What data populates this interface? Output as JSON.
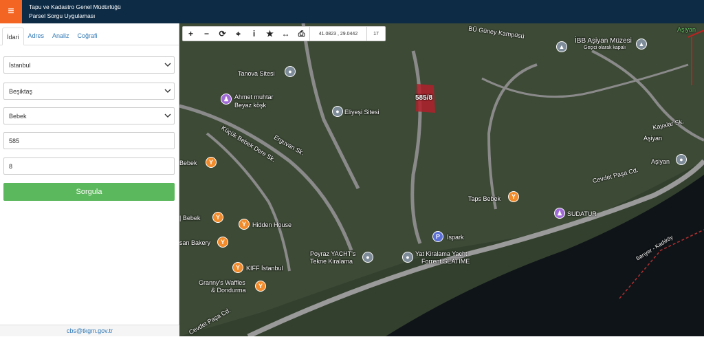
{
  "header": {
    "menu_icon": "≡",
    "title": "Tapu ve Kadastro Genel Müdürlüğü",
    "subtitle": "Parsel Sorgu Uygulaması",
    "bg_color": "#0d2b45",
    "accent_color": "#f26522"
  },
  "sidebar": {
    "tabs": [
      {
        "label": "İdari"
      },
      {
        "label": "Adres"
      },
      {
        "label": "Analiz"
      },
      {
        "label": "Coğrafi"
      }
    ],
    "fields": {
      "province": "İstanbul",
      "district": "Beşiktaş",
      "neighborhood": "Bebek",
      "block": "585",
      "parcel": "8"
    },
    "submit_label": "Sorgula",
    "submit_color": "#5cb85c",
    "footer_email": "cbs@tkgm.gov.tr"
  },
  "map": {
    "toolbar": {
      "zoom_in": "+",
      "zoom_out": "−",
      "refresh": "⟳",
      "locate": "⌖",
      "info": "i",
      "bookmark": "★",
      "measure": "↔",
      "print": "⎙",
      "coordinates": "41.0823 , 29.0442",
      "zoom_level": "17"
    },
    "parcel_label": "585/8",
    "labels": {
      "bu_guney": "BÜ Güney Kampüsü",
      "ibb_asiyan": "İBB Aşiyan Müzesi",
      "gecici": "Geçici olarak kapalı",
      "asiyan_top": "Aşiyan",
      "tanova": "Tanova Sitesi",
      "ahmet_1": "Ahmet muhtar",
      "ahmet_2": "Beyaz köşk",
      "eliyesi": "Eliyeşi Sitesi",
      "kayalar": "Kayalar Sk.",
      "asiyan_1": "Aşiyan",
      "asiyan_2": "Aşiyan",
      "bebek": "Bebek",
      "kucuk_bebek": "Küçük Bebek Dere Sk.",
      "erguvan": "Erguvan Sk.",
      "cevdet": "Cevdet Paşa Cd.",
      "taps": "Taps Bebek",
      "sudatur": "SUDATUR",
      "bebek_left": "| Bebek",
      "hidden": "Hidden House",
      "ispark": "İspark",
      "bakery": "san Bakery",
      "poyraz_1": "Poyraz YACHT's",
      "poyraz_2": "Tekne Kiralama",
      "yat_1": "Yat Kiralama Yacht",
      "yat_2": "Forrent SEATIME",
      "kiff": "KIFF İstanbul",
      "grannys_1": "Granny's Waffles",
      "grannys_2": "& Dondurma",
      "cevdet2": "Cevdet Paşa Cd.",
      "sarıyer": "Sarıyer - Kadıköy"
    }
  }
}
